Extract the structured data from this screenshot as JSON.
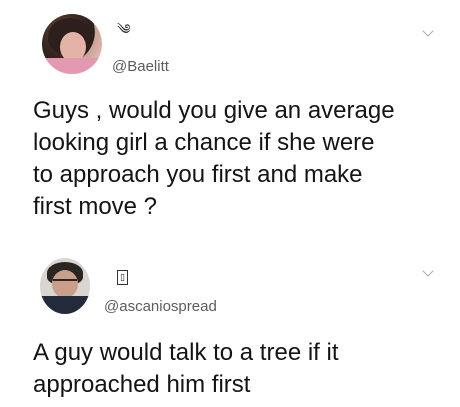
{
  "tweets": [
    {
      "glyph": "༄",
      "handle": "@Baelitt",
      "text_lines": [
        "Guys , would you give an average",
        "looking girl a chance if she were",
        "to approach you first and make",
        "first move ?"
      ],
      "avatar_icon": "user-avatar-photo",
      "menu_icon": "chevron-down-icon"
    },
    {
      "glyph": "▯",
      "handle": "@ascaniospread",
      "text_lines": [
        "A guy would talk to a tree if it",
        "approached him first"
      ],
      "avatar_icon": "user-avatar-photo",
      "menu_icon": "chevron-down-icon"
    }
  ]
}
